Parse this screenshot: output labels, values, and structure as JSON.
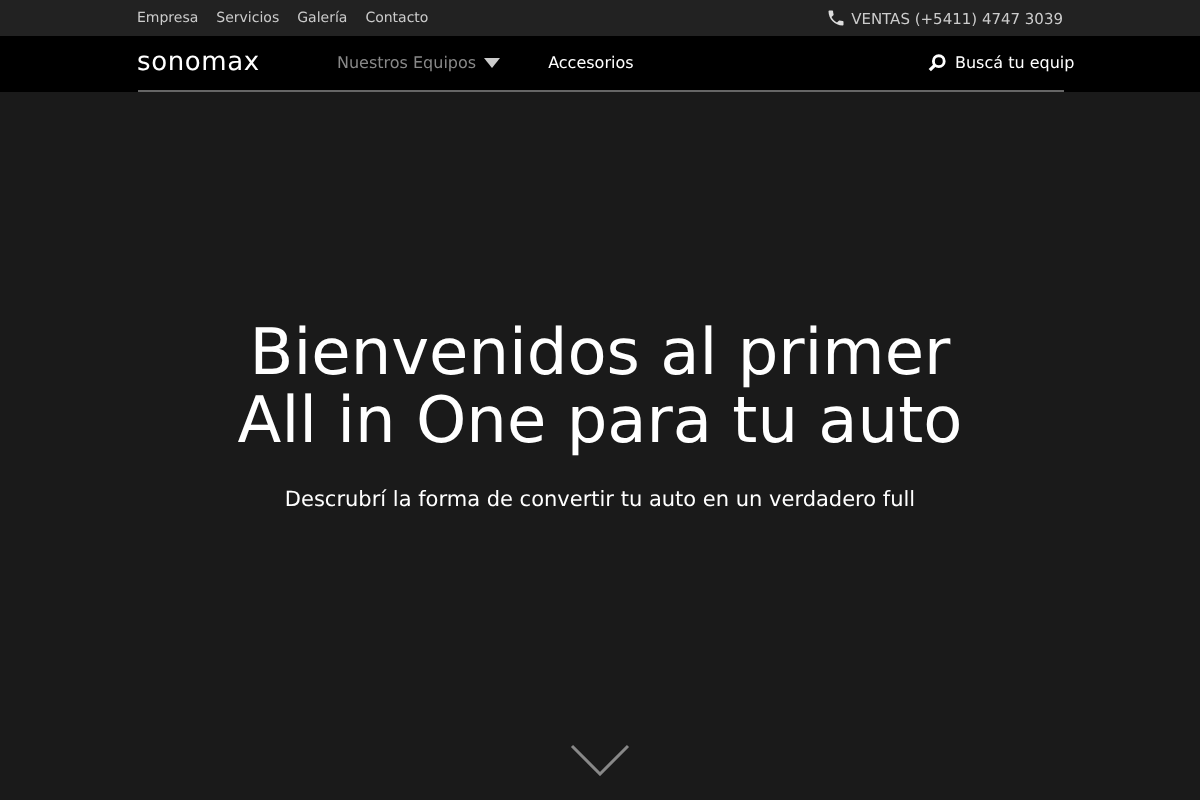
{
  "top_bar": {
    "links": [
      "Empresa",
      "Servicios",
      "Galería",
      "Contacto"
    ],
    "phone": "VENTAS (+5411) 4747 3039"
  },
  "nav": {
    "logo": "sonomax",
    "items": [
      {
        "label": "Nuestros Equipos",
        "selected": true,
        "has_menu": true
      },
      {
        "label": "Accesorios",
        "selected": false,
        "has_menu": false
      }
    ],
    "search": {
      "placeholder": "Buscá tu equip"
    }
  },
  "hero": {
    "title_lines": [
      "Bienvenidos al primer",
      "All in One para tu auto"
    ],
    "subtitle": "Descrubrí la forma de convertir tu auto en un verdadero full"
  }
}
